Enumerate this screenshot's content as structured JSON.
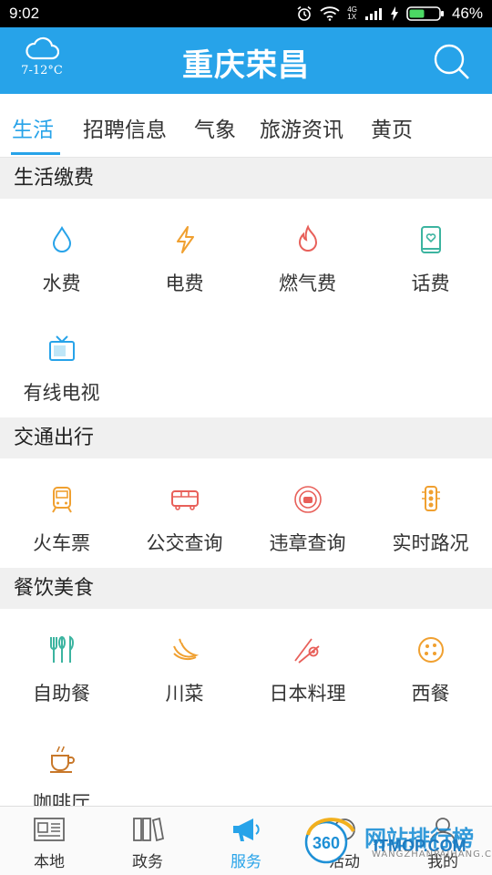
{
  "status_bar": {
    "time": "9:02",
    "net_top": "4G",
    "net_bottom": "1X",
    "battery": "46%"
  },
  "header": {
    "title": "重庆荣昌",
    "weather_temp": "7-12°C"
  },
  "tabs": [
    {
      "label": "生活",
      "active": true
    },
    {
      "label": "招聘信息"
    },
    {
      "label": "气象"
    },
    {
      "label": "旅游资讯"
    },
    {
      "label": "黄页"
    }
  ],
  "sections": {
    "life_payment": {
      "title": "生活缴费",
      "items": [
        "水费",
        "电费",
        "燃气费",
        "话费",
        "有线电视"
      ]
    },
    "transport": {
      "title": "交通出行",
      "items": [
        "火车票",
        "公交查询",
        "违章查询",
        "实时路况"
      ]
    },
    "food": {
      "title": "餐饮美食",
      "items": [
        "自助餐",
        "川菜",
        "日本料理",
        "西餐",
        "咖啡厅"
      ]
    }
  },
  "bottom_nav": [
    {
      "label": "本地"
    },
    {
      "label": "政务"
    },
    {
      "label": "服务",
      "active": true
    },
    {
      "label": "活动"
    },
    {
      "label": "我的"
    }
  ],
  "watermark": {
    "text": "网站排行榜",
    "brand": "ITMOP.COM",
    "sub": "WANGZHANPAIHANG.CN",
    "logo": "360"
  },
  "colors": {
    "accent": "#27a3e9",
    "orange": "#f0a030",
    "red": "#e8605a",
    "teal": "#3cb4a0"
  }
}
